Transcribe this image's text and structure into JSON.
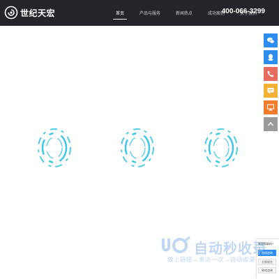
{
  "header": {
    "logo_text": "世纪天宏",
    "nav": [
      {
        "label": "首页",
        "active": true
      },
      {
        "label": "产品与服务",
        "active": false
      },
      {
        "label": "新闻热点",
        "active": false
      },
      {
        "label": "成功案例",
        "active": false
      },
      {
        "label": "关于我们",
        "active": false
      }
    ],
    "phone": "400-066-3299"
  },
  "colors": {
    "header_bg": "#23252b",
    "loader_ring": "#3cc7e6",
    "float_blue": "#2d8cf0",
    "float_red": "#e86b5f",
    "float_yellow": "#f2b134",
    "float_orange": "#f07c2c",
    "float_gray": "#9a9a9a"
  },
  "float_bar": [
    {
      "name": "wechat-icon",
      "color": "#2d8cf0"
    },
    {
      "name": "qq-icon",
      "color": "#2d8cf0"
    },
    {
      "name": "phone-icon",
      "color": "#e86b5f"
    },
    {
      "name": "message-icon",
      "color": "#f2b134"
    },
    {
      "name": "monitor-icon",
      "color": "#f07c2c"
    },
    {
      "name": "back-to-top-icon",
      "color": "#9a9a9a"
    }
  ],
  "consult": {
    "question": "需要帮助吗?",
    "online": "在线咨询",
    "btn2": "立即留言",
    "btn3": "致电咨询"
  },
  "watermark": {
    "title": "自动秒收录",
    "subtitle": "做上链接→来访一次→自动收录"
  }
}
